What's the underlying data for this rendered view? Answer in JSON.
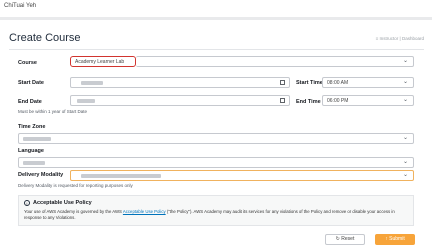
{
  "header": {
    "user": "ChiTuai Yeh"
  },
  "page": {
    "title": "Create Course",
    "breadcrumb": "≡ Instructor | Dashboard"
  },
  "form": {
    "course": {
      "label": "Course",
      "value": "Academy Learner Lab"
    },
    "start_date": {
      "label": "Start Date"
    },
    "start_time": {
      "label": "Start Time",
      "value": "08:00 AM"
    },
    "end_date": {
      "label": "End Date",
      "hint": "Must be within 1 year of Start Date"
    },
    "end_time": {
      "label": "End Time",
      "value": "06:00 PM"
    },
    "time_zone": {
      "label": "Time Zone"
    },
    "language": {
      "label": "Language"
    },
    "delivery_modality": {
      "label": "Delivery Modality",
      "hint": "Delivery Modality is requested for reporting purposes only"
    }
  },
  "policy": {
    "title": "Acceptable Use Policy",
    "text_before": "Your use of AWS Academy is governed by the AWS ",
    "link_text": "Acceptable Use Policy",
    "text_after": " (\"the Policy\"). AWS Academy may audit its services for any violations of the Policy and remove or disable your access in response to any Violations."
  },
  "actions": {
    "reset_label": "Reset",
    "submit_label": "Submit"
  }
}
